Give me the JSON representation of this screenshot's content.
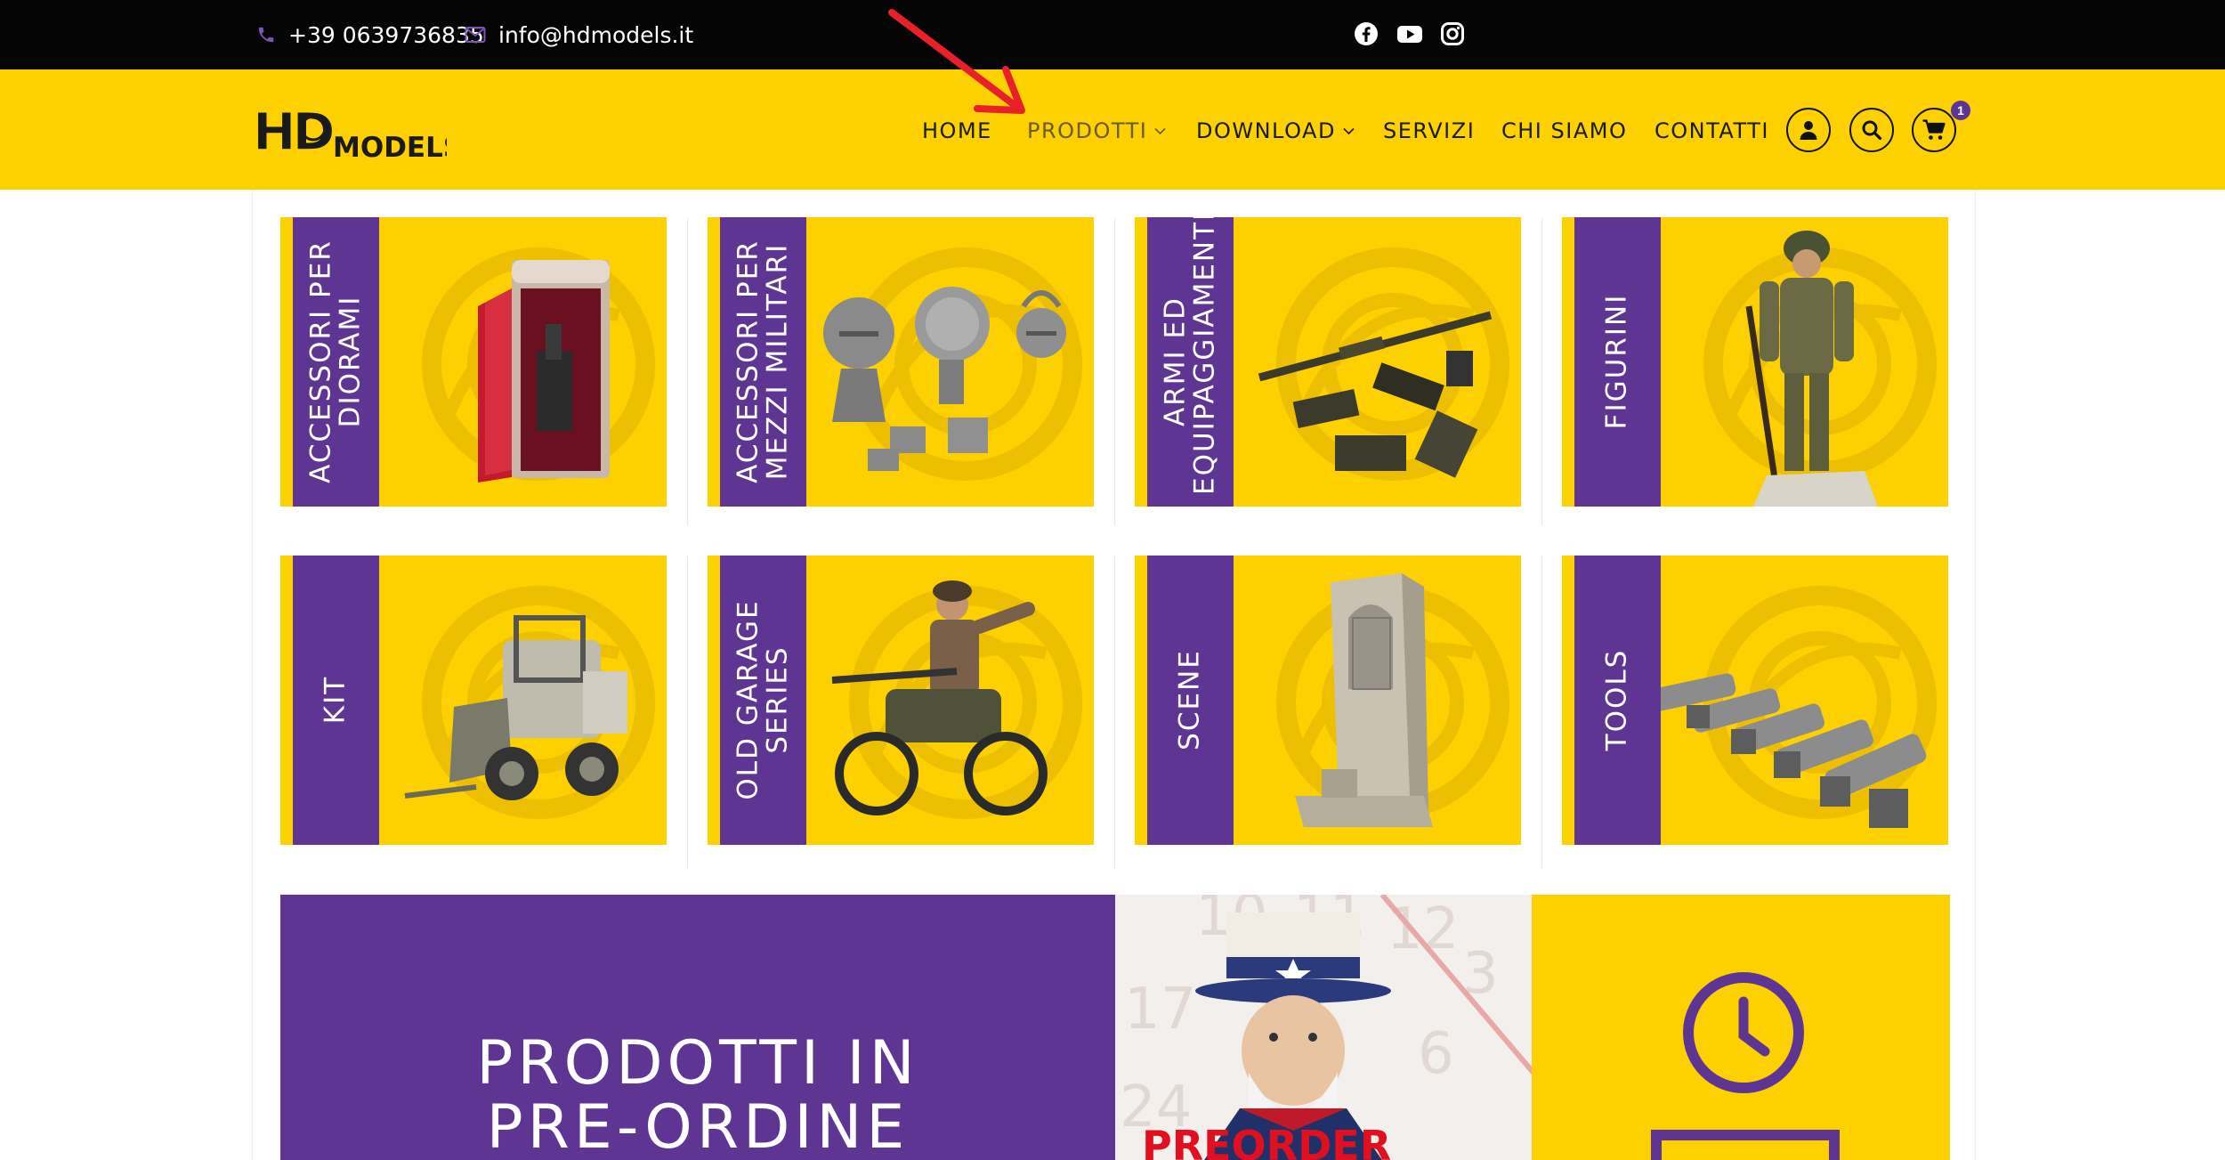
{
  "topbar": {
    "phone": "+39 0639736835",
    "email": "info@hdmodels.it",
    "social_icons": [
      "facebook-icon",
      "youtube-icon",
      "instagram-icon"
    ]
  },
  "logo": {
    "brand_mark": "HD",
    "brand_text": "MODELS"
  },
  "nav": {
    "home": "HOME",
    "prodotti": "PRODOTTI",
    "download": "DOWNLOAD",
    "servizi": "SERVIZI",
    "chi_siamo": "CHI SIAMO",
    "contatti": "CONTATTI",
    "cart_count": "1"
  },
  "categories": [
    {
      "label_1": "ACCESSORI PER",
      "label_2": "DIORAMI"
    },
    {
      "label_1": "ACCESSORI PER",
      "label_2": "MEZZI MILITARI"
    },
    {
      "label_1": "ARMI ED",
      "label_2": "EQUIPAGGIAMENTI"
    },
    {
      "label_1": "FIGURINI",
      "label_2": ""
    },
    {
      "label_1": "KIT",
      "label_2": ""
    },
    {
      "label_1": "OLD GARAGE",
      "label_2": "SERIES"
    },
    {
      "label_1": "SCENE",
      "label_2": ""
    },
    {
      "label_1": "TOOLS",
      "label_2": ""
    }
  ],
  "preorder": {
    "line_1": "PRODOTTI IN",
    "line_2": "PRE-ORDINE"
  },
  "poster": {
    "calendar_numbers": [
      "10",
      "11",
      "12",
      "17",
      "24",
      "6",
      "3"
    ],
    "stamp_text": "PREORDER"
  },
  "colors": {
    "yellow": "#fdd000",
    "purple": "#5e3593",
    "black": "#050505",
    "arrow": "#e8202a"
  }
}
